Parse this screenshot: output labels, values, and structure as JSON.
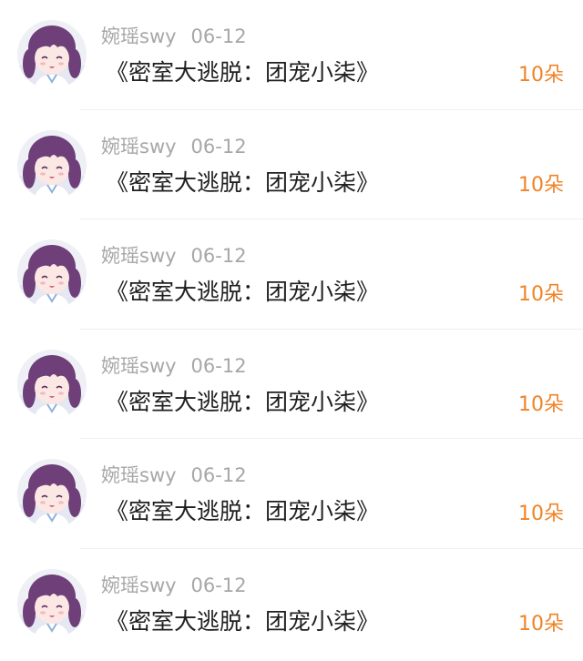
{
  "items": [
    {
      "username": "婉瑶swy",
      "date": "06-12",
      "title": "《密室大逃脱：团宠小柒》",
      "count": "10朵",
      "avatar": "anime-girl-avatar"
    },
    {
      "username": "婉瑶swy",
      "date": "06-12",
      "title": "《密室大逃脱：团宠小柒》",
      "count": "10朵",
      "avatar": "anime-girl-avatar"
    },
    {
      "username": "婉瑶swy",
      "date": "06-12",
      "title": "《密室大逃脱：团宠小柒》",
      "count": "10朵",
      "avatar": "anime-girl-avatar"
    },
    {
      "username": "婉瑶swy",
      "date": "06-12",
      "title": "《密室大逃脱：团宠小柒》",
      "count": "10朵",
      "avatar": "anime-girl-avatar"
    },
    {
      "username": "婉瑶swy",
      "date": "06-12",
      "title": "《密室大逃脱：团宠小柒》",
      "count": "10朵",
      "avatar": "anime-girl-avatar"
    },
    {
      "username": "婉瑶swy",
      "date": "06-12",
      "title": "《密室大逃脱：团宠小柒》",
      "count": "10朵",
      "avatar": "anime-girl-avatar"
    }
  ],
  "colors": {
    "accent": "#ef8427",
    "meta_text": "#a7a7a7",
    "title_text": "#1f1f1f",
    "hair": "#6e3f78",
    "skin": "#fbe7e4"
  }
}
